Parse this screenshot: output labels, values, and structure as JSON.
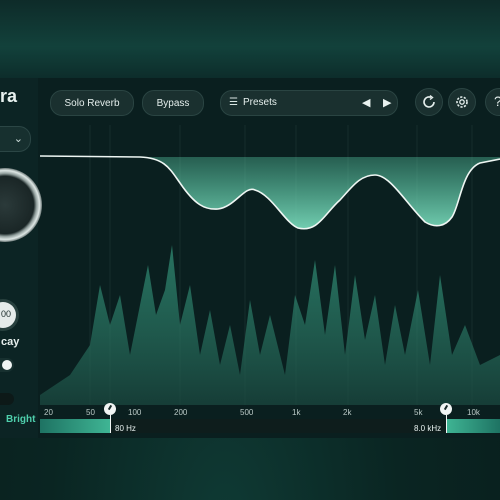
{
  "plugin": {
    "logo_fragment": "ra",
    "left_controls": {
      "small_knob_value": "00",
      "decay_label": "cay",
      "bright_label": "Bright"
    }
  },
  "toolbar": {
    "solo_reverb_label": "Solo Reverb",
    "bypass_label": "Bypass",
    "presets_label": "Presets",
    "help_label": "?"
  },
  "icons": {
    "list": "list-icon",
    "prev": "prev-arrow-icon",
    "next": "next-arrow-icon",
    "reset": "refresh-icon",
    "settings": "gear-icon",
    "help": "question-icon",
    "dropdown": "chevron-down-icon"
  },
  "colors": {
    "accent": "#3fb594",
    "accent_light": "#7de0c0",
    "background": "#0a1f1f",
    "curve": "#e9f2ef"
  },
  "frequency_axis": [
    "20",
    "50",
    "100",
    "200",
    "500",
    "1k",
    "2k",
    "5k",
    "10k"
  ],
  "filter": {
    "low_cut": "80 Hz",
    "high_cut": "8.0 kHz"
  }
}
